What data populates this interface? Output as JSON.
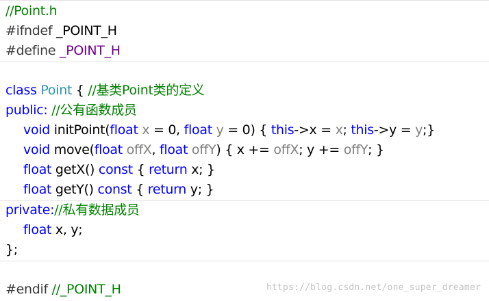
{
  "colors": {
    "comment": "#008000",
    "preprocessor": "#3a3a3a",
    "macro": "#6f008a",
    "keyword": "#0000ff",
    "type_name": "#2b91af",
    "param": "#808080",
    "plain": "#000000",
    "watermark": "#c3c3c3"
  },
  "code_lines": [
    [
      {
        "t": "//Point.h",
        "c": "comment"
      }
    ],
    [
      {
        "t": "#ifndef",
        "c": "preprocessor"
      },
      {
        "t": " _POINT_H",
        "c": "plain"
      }
    ],
    [
      {
        "t": "#define",
        "c": "preprocessor"
      },
      {
        "t": " ",
        "c": "plain"
      },
      {
        "t": "_POINT_H",
        "c": "macro"
      }
    ],
    [],
    [
      {
        "t": "class",
        "c": "keyword"
      },
      {
        "t": " ",
        "c": "plain"
      },
      {
        "t": "Point",
        "c": "type_name"
      },
      {
        "t": " { ",
        "c": "plain"
      },
      {
        "t": "//基类Point类的定义",
        "c": "comment"
      }
    ],
    [
      {
        "t": "public:",
        "c": "keyword"
      },
      {
        "t": " ",
        "c": "plain"
      },
      {
        "t": "//公有函数成员",
        "c": "comment"
      }
    ],
    [
      {
        "t": "void",
        "c": "keyword"
      },
      {
        "t": " initPoint(",
        "c": "plain"
      },
      {
        "t": "float",
        "c": "keyword"
      },
      {
        "t": " ",
        "c": "plain"
      },
      {
        "t": "x",
        "c": "param"
      },
      {
        "t": " = 0, ",
        "c": "plain"
      },
      {
        "t": "float",
        "c": "keyword"
      },
      {
        "t": " ",
        "c": "plain"
      },
      {
        "t": "y",
        "c": "param"
      },
      {
        "t": " = 0) { ",
        "c": "plain"
      },
      {
        "t": "this",
        "c": "keyword"
      },
      {
        "t": "->x = ",
        "c": "plain"
      },
      {
        "t": "x",
        "c": "param"
      },
      {
        "t": "; ",
        "c": "plain"
      },
      {
        "t": "this",
        "c": "keyword"
      },
      {
        "t": "->y = ",
        "c": "plain"
      },
      {
        "t": "y",
        "c": "param"
      },
      {
        "t": ";}",
        "c": "plain"
      }
    ],
    [
      {
        "t": "void",
        "c": "keyword"
      },
      {
        "t": " move(",
        "c": "plain"
      },
      {
        "t": "float",
        "c": "keyword"
      },
      {
        "t": " ",
        "c": "plain"
      },
      {
        "t": "offX",
        "c": "param"
      },
      {
        "t": ", ",
        "c": "plain"
      },
      {
        "t": "float",
        "c": "keyword"
      },
      {
        "t": " ",
        "c": "plain"
      },
      {
        "t": "offY",
        "c": "param"
      },
      {
        "t": ") { x += ",
        "c": "plain"
      },
      {
        "t": "offX",
        "c": "param"
      },
      {
        "t": "; y += ",
        "c": "plain"
      },
      {
        "t": "offY",
        "c": "param"
      },
      {
        "t": "; }",
        "c": "plain"
      }
    ],
    [
      {
        "t": "float",
        "c": "keyword"
      },
      {
        "t": " getX() ",
        "c": "plain"
      },
      {
        "t": "const",
        "c": "keyword"
      },
      {
        "t": " { ",
        "c": "plain"
      },
      {
        "t": "return",
        "c": "keyword"
      },
      {
        "t": " x; }",
        "c": "plain"
      }
    ],
    [
      {
        "t": "float",
        "c": "keyword"
      },
      {
        "t": " getY() ",
        "c": "plain"
      },
      {
        "t": "const",
        "c": "keyword"
      },
      {
        "t": " { ",
        "c": "plain"
      },
      {
        "t": "return",
        "c": "keyword"
      },
      {
        "t": " y; }",
        "c": "plain"
      }
    ],
    [
      {
        "t": "private:",
        "c": "keyword"
      },
      {
        "t": "//私有数据成员",
        "c": "comment"
      }
    ],
    [
      {
        "t": "float",
        "c": "keyword"
      },
      {
        "t": " x, y;",
        "c": "plain"
      }
    ],
    [
      {
        "t": "};",
        "c": "plain"
      }
    ],
    [],
    [
      {
        "t": "#endif",
        "c": "preprocessor"
      },
      {
        "t": " ",
        "c": "plain"
      },
      {
        "t": "//_POINT_H",
        "c": "comment"
      }
    ]
  ],
  "watermark": "https://blog.csdn.net/one_super_dreamer"
}
